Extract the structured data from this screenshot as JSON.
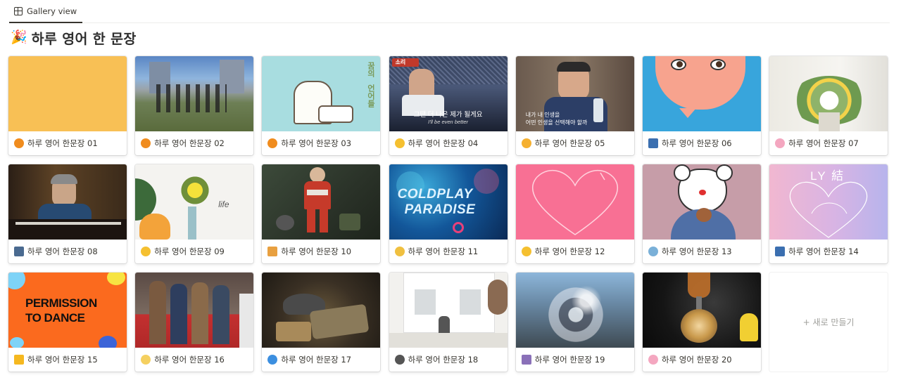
{
  "tab": {
    "label": "Gallery view",
    "icon": "grid-icon"
  },
  "title": {
    "icon": "🎉",
    "text": "하루 영어 한 문장"
  },
  "cards": [
    {
      "title": "하루 영어 한문장 01",
      "icon": "orange-icon",
      "icon_color": "#f08c1e"
    },
    {
      "title": "하루 영어 한문장 02",
      "icon": "orange-icon",
      "icon_color": "#f08c1e"
    },
    {
      "title": "하루 영어 한문장 03",
      "icon": "orange-icon",
      "icon_color": "#f08c1e"
    },
    {
      "title": "하루 영어 한문장 04",
      "icon": "smiling-face-icon",
      "icon_color": "#f5c030"
    },
    {
      "title": "하루 영어 한문장 05",
      "icon": "hearts-face-icon",
      "icon_color": "#f5b030"
    },
    {
      "title": "하루 영어 한문장 06",
      "icon": "night-scene-icon",
      "icon_color": "#3b6fb0"
    },
    {
      "title": "하루 영어 한문장 07",
      "icon": "cherry-blossom-icon",
      "icon_color": "#f4a7c0"
    },
    {
      "title": "하루 영어 한문장 08",
      "icon": "cityscape-icon",
      "icon_color": "#4a6a90"
    },
    {
      "title": "하루 영어 한문장 09",
      "icon": "expressionless-face-icon",
      "icon_color": "#f5c030"
    },
    {
      "title": "하루 영어 한문장 10",
      "icon": "pencil-icon",
      "icon_color": "#e8a040"
    },
    {
      "title": "하루 영어 한문장 11",
      "icon": "sun-cloud-icon",
      "icon_color": "#f0c040"
    },
    {
      "title": "하루 영어 한문장 12",
      "icon": "relieved-face-icon",
      "icon_color": "#f5c030"
    },
    {
      "title": "하루 영어 한문장 13",
      "icon": "rugby-ball-icon",
      "icon_color": "#7ab0d8"
    },
    {
      "title": "하루 영어 한문장 14",
      "icon": "night-scene-icon",
      "icon_color": "#3b6fb0"
    },
    {
      "title": "하루 영어 한문장 15",
      "icon": "star-icon",
      "icon_color": "#f5b820"
    },
    {
      "title": "하루 영어 한문장 16",
      "icon": "moon-face-icon",
      "icon_color": "#f5d060"
    },
    {
      "title": "하루 영어 한문장 17",
      "icon": "blue-circle-icon",
      "icon_color": "#3c8fe0"
    },
    {
      "title": "하루 영어 한문장 18",
      "icon": "new-moon-icon",
      "icon_color": "#555555"
    },
    {
      "title": "하루 영어 한문장 19",
      "icon": "carousel-horse-icon",
      "icon_color": "#8a70b8"
    },
    {
      "title": "하루 영어 한문장 20",
      "icon": "cherry-blossom-icon",
      "icon_color": "#f4a7c0"
    }
  ],
  "covers": {
    "c3": {
      "line1": "꿈의",
      "line2": "언어들"
    },
    "c4": {
      "badge": "소리",
      "subtitle_ko": "그땐 더 나은 제가 될게요",
      "subtitle_en": "I'll be even better"
    },
    "c5": {
      "subtitle": "내가 내 인생을",
      "subtitle2": "어떤 인생을 선택해야 할까"
    },
    "c9": {
      "script": "life"
    },
    "c11": {
      "line1": "COLDPLAY",
      "line2": "PARADISE"
    },
    "c14": {
      "mark": "LY 結"
    },
    "c15": {
      "line1": "PERMISSION",
      "line2": "TO DANCE"
    }
  },
  "new_card": {
    "label": "+ 새로 만들기"
  }
}
